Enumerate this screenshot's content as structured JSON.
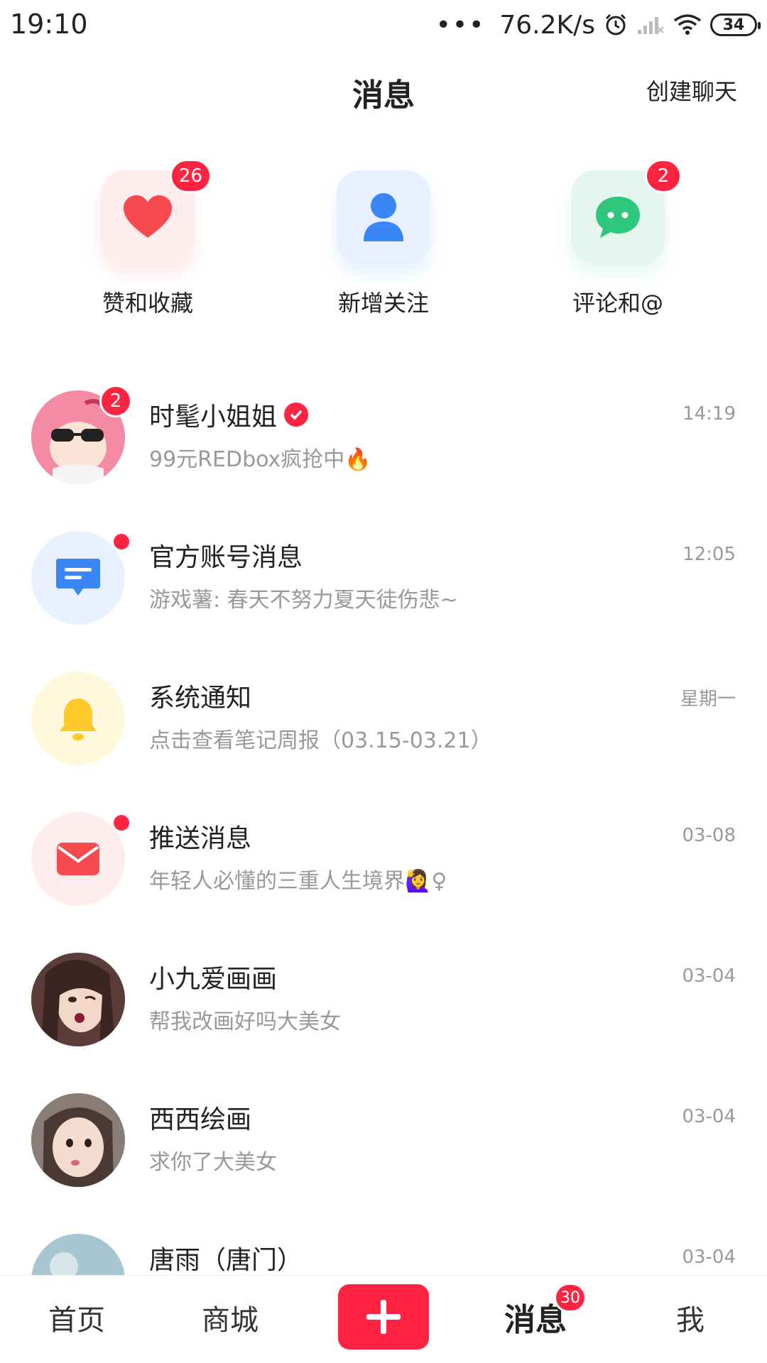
{
  "status_bar": {
    "time": "19:10",
    "dots": "•••",
    "network_speed": "76.2K/s",
    "battery": "34",
    "icons": [
      "alarm-icon",
      "signal-icon",
      "wifi-icon",
      "battery-icon"
    ]
  },
  "header": {
    "title": "消息",
    "create_chat_label": "创建聊天"
  },
  "quick_actions": [
    {
      "label": "赞和收藏",
      "badge": "26",
      "icon": "heart-icon",
      "tile_color": "#ffeced",
      "icon_color": "#f64a4f"
    },
    {
      "label": "新增关注",
      "badge": "",
      "icon": "person-icon",
      "tile_color": "#e6f0ff",
      "icon_color": "#3a86f5"
    },
    {
      "label": "评论和@",
      "badge": "2",
      "icon": "chat-bubble-icon",
      "tile_color": "#e4f7ee",
      "icon_color": "#2fc77e"
    }
  ],
  "messages": [
    {
      "name": "时髦小姐姐",
      "preview": "99元REDbox疯抢中🔥",
      "time": "14:19",
      "badge": "2",
      "verified": true,
      "avatar": "photo"
    },
    {
      "name": "官方账号消息",
      "preview": "游戏薯: 春天不努力夏天徒伤悲~",
      "time": "12:05",
      "dot": true,
      "avatar": "message-icon"
    },
    {
      "name": "系统通知",
      "preview": "点击查看笔记周报（03.15-03.21）",
      "time": "星期一",
      "avatar": "bell-icon"
    },
    {
      "name": "推送消息",
      "preview": "年轻人必懂的三重人生境界🙋‍♀️♀",
      "time": "03-08",
      "dot": true,
      "avatar": "envelope-icon"
    },
    {
      "name": "小九爱画画",
      "preview": "帮我改画好吗大美女",
      "time": "03-04",
      "avatar": "photo"
    },
    {
      "name": "西西绘画",
      "preview": "求你了大美女",
      "time": "03-04",
      "avatar": "photo"
    },
    {
      "name": "唐雨（唐门）",
      "preview": "",
      "time": "03-04",
      "avatar": "photo"
    }
  ],
  "bottom_nav": {
    "home": "首页",
    "mall": "商城",
    "messages": "消息",
    "messages_badge": "30",
    "me": "我"
  },
  "colors": {
    "accent": "#ff2442",
    "text_primary": "#222222",
    "text_secondary": "#999999"
  }
}
